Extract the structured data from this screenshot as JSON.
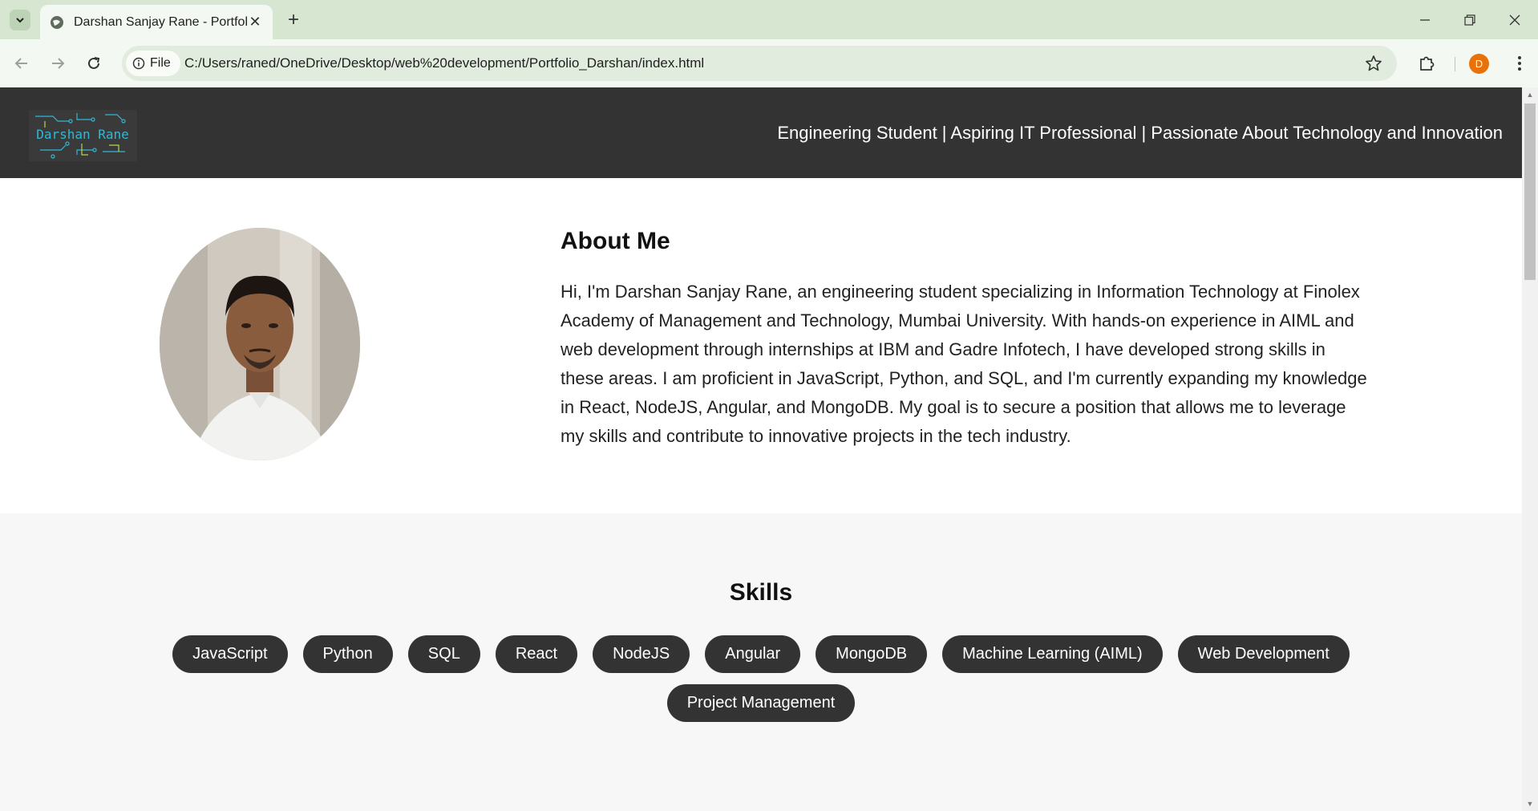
{
  "browser": {
    "tab_title": "Darshan Sanjay Rane - Portfolio",
    "site_chip_label": "File",
    "url": "C:/Users/raned/OneDrive/Desktop/web%20development/Portfolio_Darshan/index.html",
    "profile_initial": "D",
    "profile_color": "#e8710a"
  },
  "header": {
    "logo_text": "Darshan Rane",
    "tagline": "Engineering Student | Aspiring IT Professional | Passionate About Technology and Innovation",
    "background": "#333333"
  },
  "about": {
    "title": "About Me",
    "text": "Hi, I'm Darshan Sanjay Rane, an engineering student specializing in Information Technology at Finolex Academy of Management and Technology, Mumbai University. With hands-on experience in AIML and web development through internships at IBM and Gadre Infotech, I have developed strong skills in these areas. I am proficient in JavaScript, Python, and SQL, and I'm currently expanding my knowledge in React, NodeJS, Angular, and MongoDB. My goal is to secure a position that allows me to leverage my skills and contribute to innovative projects in the tech industry."
  },
  "skills": {
    "title": "Skills",
    "items": [
      "JavaScript",
      "Python",
      "SQL",
      "React",
      "NodeJS",
      "Angular",
      "MongoDB",
      "Machine Learning (AIML)",
      "Web Development",
      "Project Management"
    ]
  },
  "colors": {
    "accent_logo": "#2fb8d6",
    "pill_bg": "#333333"
  }
}
